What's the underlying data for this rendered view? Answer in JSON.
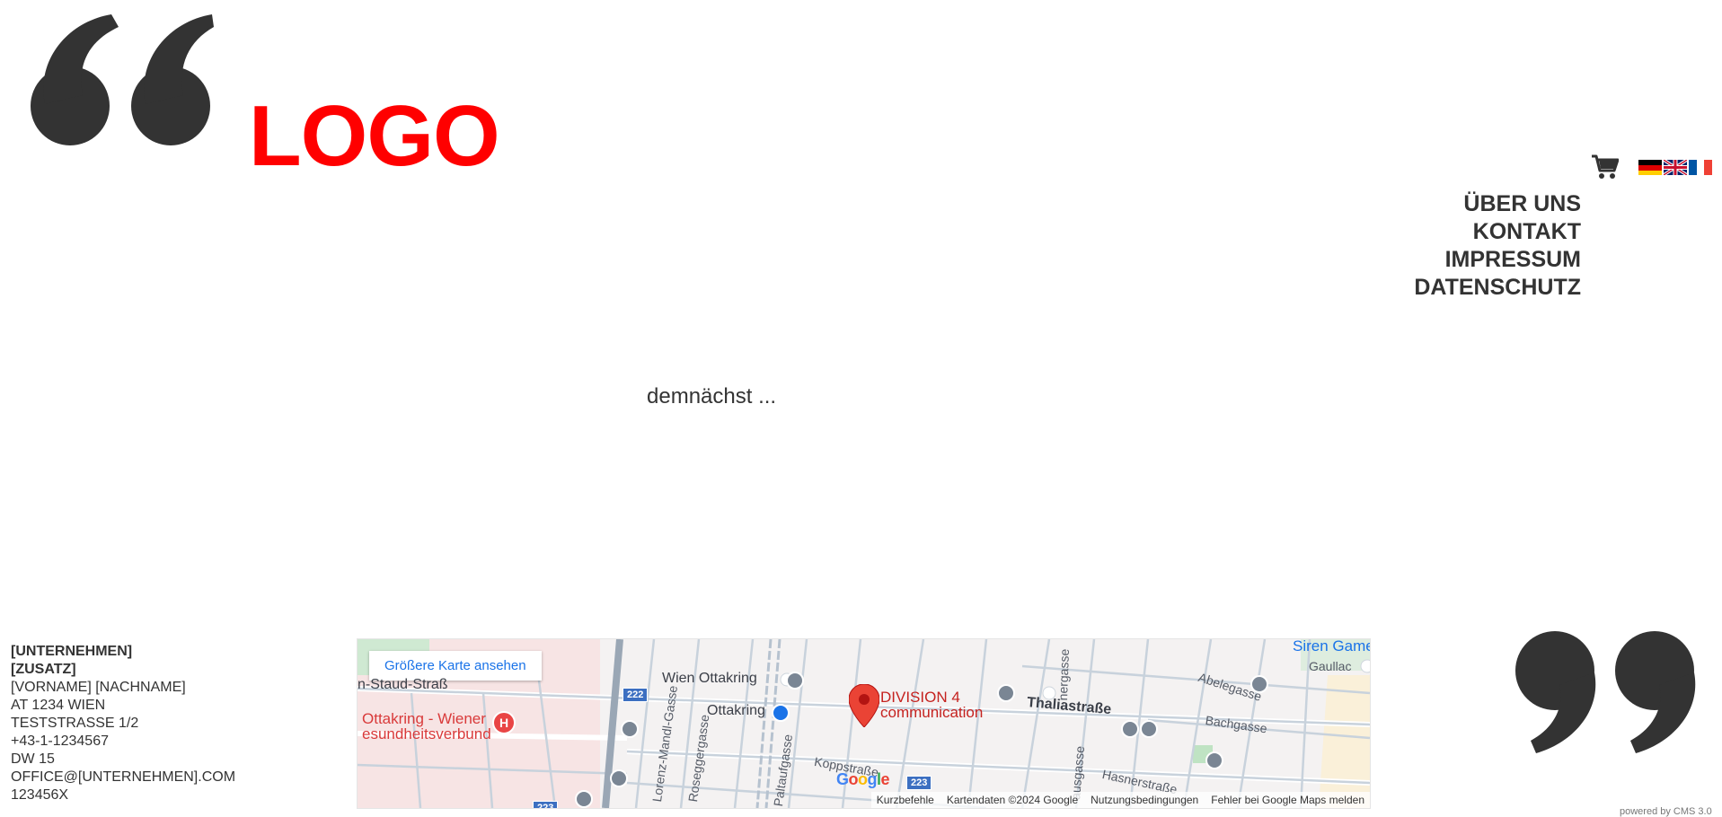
{
  "header": {
    "logo_text": "LOGO"
  },
  "nav": {
    "items": [
      "ÜBER UNS",
      "KONTAKT",
      "IMPRESSUM",
      "DATENSCHUTZ"
    ]
  },
  "languages": [
    "de",
    "en",
    "fr"
  ],
  "main": {
    "coming_soon": "demnächst ..."
  },
  "footer": {
    "address": {
      "company": "[UNTERNEHMEN]",
      "addition": "[ZUSATZ]",
      "name": "[VORNAME] [NACHNAME]",
      "city": "AT 1234 WIEN",
      "street": "TESTSTRASSE 1/2",
      "phone": "+43-1-1234567",
      "extension": "DW 15",
      "email": "OFFICE@[UNTERNEHMEN].COM",
      "id": "123456X"
    },
    "powered": "powered by CMS 3.0"
  },
  "map": {
    "button": "Größere Karte ansehen",
    "marker_label_1": "DIVISION 4",
    "marker_label_2": "communication",
    "hospital_1": "Ottakring - Wiener",
    "hospital_2": "esundheitsverbund",
    "labels": {
      "wien_ottakring": "Wien Ottakring",
      "ottakring": "Ottakring",
      "thaliastrasse": "Thaliastraße",
      "staud": "n-Staud-Straß",
      "siren": "Siren Game",
      "gaullac": "Gaullac",
      "abelegasse": "Abelegasse",
      "bachgasse": "Bachgasse",
      "hasnerstrasse": "Hasnerstraße",
      "koppstrasse": "Koppstraße",
      "paltaufgasse": "Paltaufgasse",
      "roseggergasse": "Roseggergasse",
      "lorenz": "Lorenz-Mandl-Gasse",
      "nergasse": "nergasse",
      "ausgasse": "ausgasse"
    },
    "shields": [
      "222",
      "223",
      "223"
    ],
    "google": "Google",
    "attribution": [
      "Kurzbefehle",
      "Kartendaten ©2024 Google",
      "Nutzungsbedingungen",
      "Fehler bei Google Maps melden"
    ]
  },
  "colors": {
    "logo": "#ff0000",
    "text": "#333333",
    "marker": "#ea4335",
    "link": "#1a73e8"
  },
  "icons": [
    "quote-open-icon",
    "cart-icon",
    "flag-de-icon",
    "flag-en-icon",
    "flag-fr-icon",
    "map-marker-icon",
    "hospital-icon",
    "quote-close-icon"
  ]
}
